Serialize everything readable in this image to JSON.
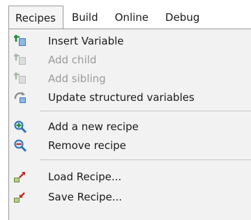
{
  "menubar": {
    "items": [
      {
        "label": "Recipes",
        "active": true
      },
      {
        "label": "Build"
      },
      {
        "label": "Online"
      },
      {
        "label": "Debug"
      }
    ]
  },
  "menu": {
    "items": [
      {
        "label": "Insert Variable",
        "icon": "insert-variable-icon",
        "enabled": true
      },
      {
        "label": "Add child",
        "icon": "add-child-icon",
        "enabled": false
      },
      {
        "label": "Add sibling",
        "icon": "add-sibling-icon",
        "enabled": false
      },
      {
        "label": "Update structured variables",
        "icon": "update-variables-icon",
        "enabled": true
      },
      {
        "label": "Add a new recipe",
        "icon": "add-recipe-icon",
        "enabled": true
      },
      {
        "label": "Remove recipe",
        "icon": "remove-recipe-icon",
        "enabled": true
      },
      {
        "label": "Load Recipe...",
        "icon": "load-recipe-icon",
        "enabled": true
      },
      {
        "label": "Save Recipe...",
        "icon": "save-recipe-icon",
        "enabled": true
      }
    ]
  },
  "colors": {
    "menu_background": "#f2f2f2",
    "disabled_text": "#9a9a9a",
    "icon_green": "#1e8a3c",
    "icon_blue": "#2f6fb8",
    "icon_red": "#c0281e"
  }
}
